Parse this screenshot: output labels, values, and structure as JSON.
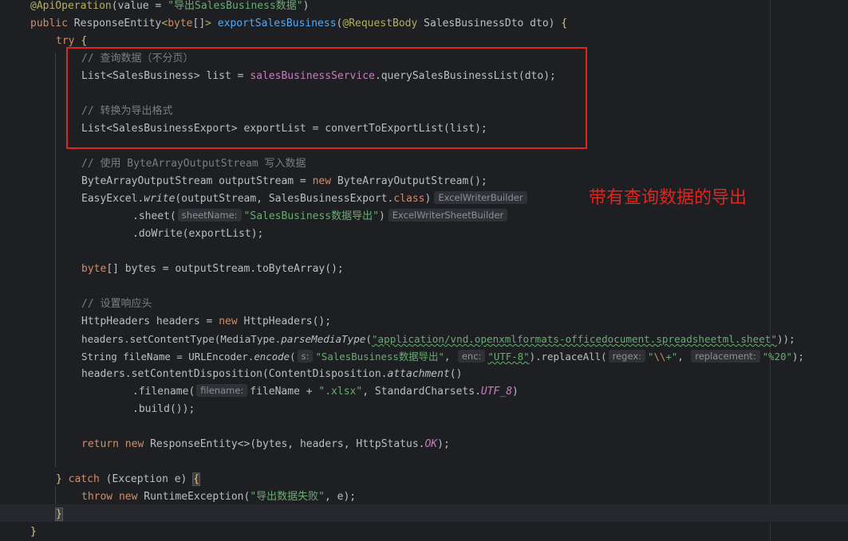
{
  "colors": {
    "background": "#1e1f22",
    "keyword": "#cf8e6d",
    "annotation": "#b3ae60",
    "string": "#6aab73",
    "comment": "#7a7e85",
    "method": "#56a8f5",
    "field": "#c77dbb",
    "highlight_box": "#e0251f"
  },
  "annotation_note": "带有查询数据的导出",
  "code": {
    "l1": {
      "ann": "@ApiOperation",
      "p1": "(value = ",
      "str": "\"导出SalesBusiness数据\"",
      "p2": ")"
    },
    "l2": {
      "kw": "public",
      "p1": " ResponseEntity",
      "lt": "<",
      "kw2": "byte",
      "p2": "[]",
      "gt": ">",
      "sp": " ",
      "fn": "exportSalesBusiness",
      "p3": "(",
      "ann": "@RequestBody",
      "p4": " SalesBusinessDto dto) ",
      "brace": "{"
    },
    "l3": {
      "kw": "try",
      "sp": " ",
      "brace": "{"
    },
    "l4": {
      "cmt": "// 查询数据（不分页）"
    },
    "l5": {
      "p1": "List<SalesBusiness> list = ",
      "field": "salesBusinessService",
      "p2": ".querySalesBusinessList(dto);"
    },
    "l7": {
      "cmt": "// 转换为导出格式"
    },
    "l8": {
      "p1": "List<SalesBusinessExport> exportList = convertToExportList(list);"
    },
    "l10": {
      "cmt": "// 使用 ByteArrayOutputStream 写入数据"
    },
    "l11": {
      "p1": "ByteArrayOutputStream outputStream = ",
      "kw": "new",
      "p2": " ByteArrayOutputStream();"
    },
    "l12": {
      "p1": "EasyExcel.",
      "it": "write",
      "p2": "(outputStream, SalesBusinessExport.",
      "kw": "class",
      "p3": ")",
      "hint": "ExcelWriterBuilder"
    },
    "l13": {
      "p1": ".sheet(",
      "hint": "sheetName:",
      "str": "\"SalesBusiness数据导出\"",
      "p2": ")",
      "hint2": "ExcelWriterSheetBuilder"
    },
    "l14": {
      "p1": ".doWrite(exportList);"
    },
    "l16": {
      "kw": "byte",
      "p1": "[] bytes = outputStream.toByteArray();"
    },
    "l18": {
      "cmt": "// 设置响应头"
    },
    "l19": {
      "p1": "HttpHeaders headers = ",
      "kw": "new",
      "p2": " HttpHeaders();"
    },
    "l20": {
      "p1": "headers.setContentType(MediaType.",
      "it": "parseMediaType",
      "p2": "(",
      "str": "\"application/vnd.openxmlformats-officedocument.spreadsheetml.sheet\"",
      "p3": "));"
    },
    "l21": {
      "p1": "String fileName = URLEncoder.",
      "it": "encode",
      "p2": "(",
      "hint1": "s:",
      "str1": "\"SalesBusiness数据导出\"",
      "p3": ", ",
      "hint2": "enc:",
      "str2": "\"UTF-8\"",
      "p4": ").replaceAll(",
      "hint3": "regex:",
      "str3a": "\"",
      "esc": "\\\\",
      "str3b": "+\"",
      "p5": ", ",
      "hint4": "replacement:",
      "str4": "\"%20\"",
      "p6": ");"
    },
    "l22": {
      "p1": "headers.setContentDisposition(ContentDisposition.",
      "it": "attachment",
      "p2": "()"
    },
    "l23": {
      "p1": ".filename(",
      "hint": "filename:",
      "p2": "fileName + ",
      "str": "\".xlsx\"",
      "p3": ", StandardCharsets.",
      "const": "UTF_8",
      "p4": ")"
    },
    "l24": {
      "p1": ".build());"
    },
    "l26": {
      "kw": "return",
      "sp": " ",
      "kw2": "new",
      "p1": " ResponseEntity<>(bytes, headers, HttpStatus.",
      "const": "OK",
      "p2": ");"
    },
    "l28": {
      "brace": "}",
      "sp": " ",
      "kw": "catch",
      "p1": " (Exception e) ",
      "brace2": "{"
    },
    "l29": {
      "kw": "throw",
      "sp": " ",
      "kw2": "new",
      "p1": " RuntimeException(",
      "str": "\"导出数据失败\"",
      "p2": ", e);"
    },
    "l30": {
      "brace": "}"
    },
    "l31": {
      "brace": "}"
    }
  }
}
